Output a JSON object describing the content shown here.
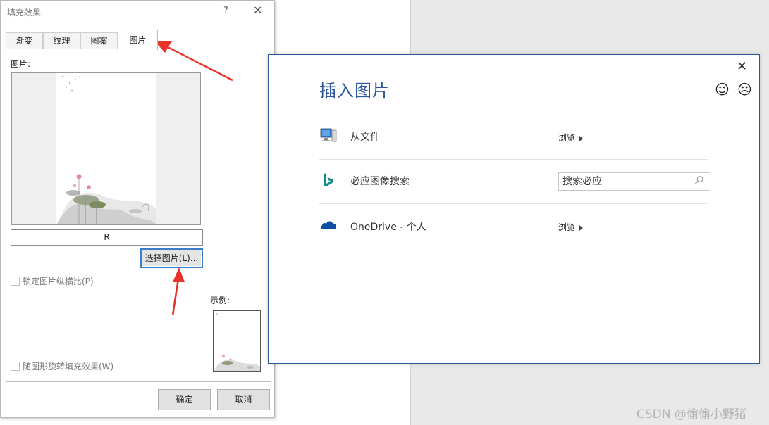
{
  "fill_dialog": {
    "title": "填充效果",
    "help": "?",
    "close": "✕",
    "tabs": [
      {
        "label": "渐变"
      },
      {
        "label": "纹理"
      },
      {
        "label": "图案"
      },
      {
        "label": "图片",
        "active": true
      }
    ],
    "picture_label": "图片:",
    "filename": "R",
    "select_button": "选择图片(L)...",
    "lock_aspect": "锁定图片纵横比(P)",
    "rotate_with_shape": "随图形旋转填充效果(W)",
    "sample_label": "示例:",
    "ok_button": "确定",
    "cancel_button": "取消"
  },
  "insert_dialog": {
    "title": "插入图片",
    "close": "✕",
    "feedback_smile": "☺",
    "feedback_frown": "☹",
    "rows": [
      {
        "icon": "computer-icon",
        "label": "从文件",
        "action": "浏览"
      },
      {
        "icon": "bing-icon",
        "label": "必应图像搜索",
        "search_placeholder": "搜索必应"
      },
      {
        "icon": "onedrive-icon",
        "label": "OneDrive - 个人",
        "action": "浏览"
      }
    ],
    "accent_color": "#2b579a"
  },
  "annotation_color": "#e8332a",
  "watermark": "CSDN @偷偷小野猪"
}
